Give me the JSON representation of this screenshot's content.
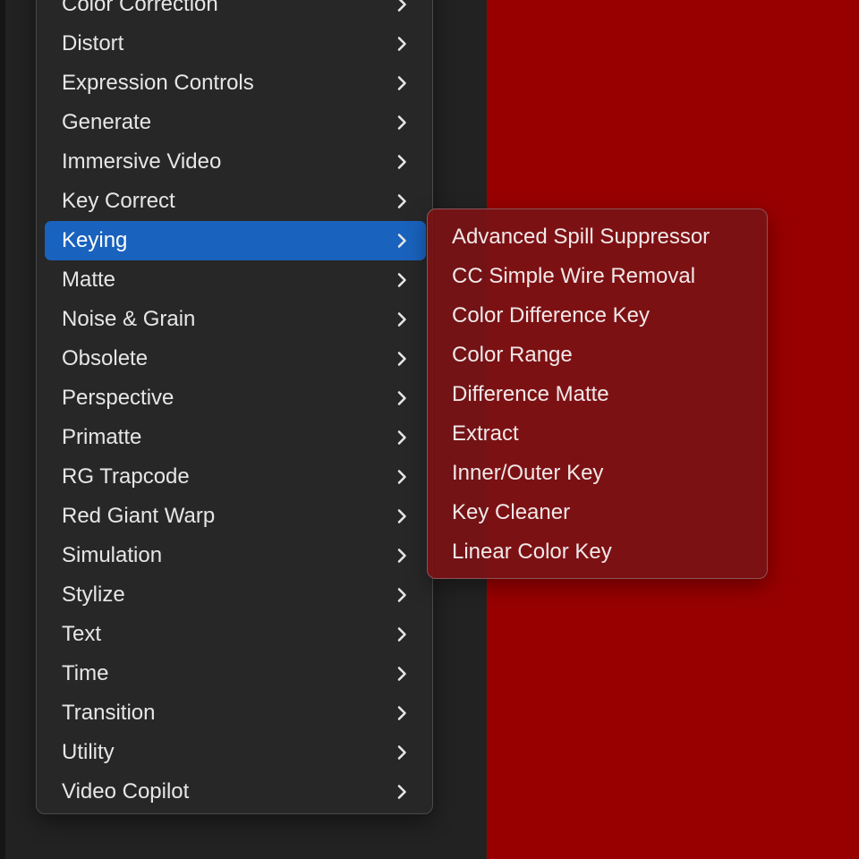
{
  "effects_menu": {
    "items": [
      {
        "label": "Color Correction",
        "icon": "chevron-right-icon",
        "selected": false
      },
      {
        "label": "Distort",
        "icon": "chevron-right-icon",
        "selected": false
      },
      {
        "label": "Expression Controls",
        "icon": "chevron-right-icon",
        "selected": false
      },
      {
        "label": "Generate",
        "icon": "chevron-right-icon",
        "selected": false
      },
      {
        "label": "Immersive Video",
        "icon": "chevron-right-icon",
        "selected": false
      },
      {
        "label": "Key Correct",
        "icon": "chevron-right-icon",
        "selected": false
      },
      {
        "label": "Keying",
        "icon": "chevron-right-icon",
        "selected": true
      },
      {
        "label": "Matte",
        "icon": "chevron-right-icon",
        "selected": false
      },
      {
        "label": "Noise & Grain",
        "icon": "chevron-right-icon",
        "selected": false
      },
      {
        "label": "Obsolete",
        "icon": "chevron-right-icon",
        "selected": false
      },
      {
        "label": "Perspective",
        "icon": "chevron-right-icon",
        "selected": false
      },
      {
        "label": "Primatte",
        "icon": "chevron-right-icon",
        "selected": false
      },
      {
        "label": "RG Trapcode",
        "icon": "chevron-right-icon",
        "selected": false
      },
      {
        "label": "Red Giant Warp",
        "icon": "chevron-right-icon",
        "selected": false
      },
      {
        "label": "Simulation",
        "icon": "chevron-right-icon",
        "selected": false
      },
      {
        "label": "Stylize",
        "icon": "chevron-right-icon",
        "selected": false
      },
      {
        "label": "Text",
        "icon": "chevron-right-icon",
        "selected": false
      },
      {
        "label": "Time",
        "icon": "chevron-right-icon",
        "selected": false
      },
      {
        "label": "Transition",
        "icon": "chevron-right-icon",
        "selected": false
      },
      {
        "label": "Utility",
        "icon": "chevron-right-icon",
        "selected": false
      },
      {
        "label": "Video Copilot",
        "icon": "chevron-right-icon",
        "selected": false
      }
    ]
  },
  "keying_submenu": {
    "items": [
      {
        "label": "Advanced Spill Suppressor"
      },
      {
        "label": "CC Simple Wire Removal"
      },
      {
        "label": "Color Difference Key"
      },
      {
        "label": "Color Range"
      },
      {
        "label": "Difference Matte"
      },
      {
        "label": "Extract"
      },
      {
        "label": "Inner/Outer Key"
      },
      {
        "label": "Key Cleaner"
      },
      {
        "label": "Linear Color Key"
      }
    ]
  },
  "colors": {
    "menu_background": "#272727",
    "selection_highlight": "#1962bd",
    "submenu_background": "#7a1216",
    "composition_background": "#980000",
    "text": "#e6e6e6"
  }
}
